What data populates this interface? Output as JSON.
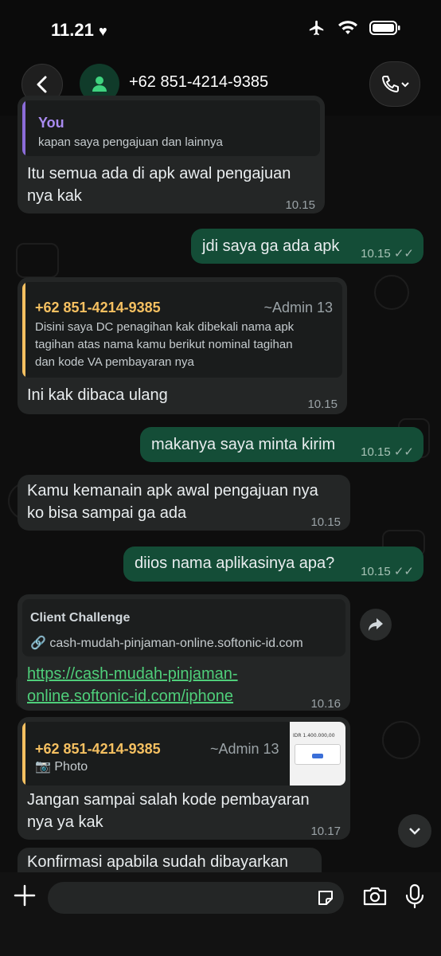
{
  "status_bar": {
    "time": "11.21"
  },
  "header": {
    "contact": "+62 851-4214-9385"
  },
  "messages": [
    {
      "quote_sender": "You",
      "quote_text": "kapan saya pengajuan dan lainnya",
      "text_line1": "Itu semua ada di apk awal pengajuan",
      "text_line2": "nya kak",
      "time": "10.15"
    },
    {
      "text": "jdi saya ga ada apk",
      "time": "10.15"
    },
    {
      "quote_sender": "+62 851-4214-9385",
      "quote_admin": "~Admin 13",
      "quote_line1": "Disini saya DC penagihan kak dibekali nama apk",
      "quote_line2": "tagihan atas nama kamu berikut nominal tagihan",
      "quote_line3": "dan kode VA pembayaran nya",
      "text": "Ini kak dibaca ulang",
      "time": "10.15"
    },
    {
      "text": "makanya saya minta kirim",
      "time": "10.15"
    },
    {
      "text_line1": "Kamu kemanain apk awal pengajuan nya",
      "text_line2": "ko bisa sampai ga ada",
      "time": "10.15"
    },
    {
      "text": "diios nama aplikasinya apa?",
      "time": "10.15"
    },
    {
      "preview_title": "Client Challenge",
      "preview_url": "cash-mudah-pinjaman-online.softonic-id.com",
      "link_line1": "https://cash-mudah-pinjaman-",
      "link_line2": "online.softonic-id.com/iphone",
      "time": "10.16"
    },
    {
      "quote_sender": "+62 851-4214-9385",
      "quote_admin": "~Admin 13",
      "quote_type": "Photo",
      "thumb_text": "IDR 1.400.000,00",
      "text_line1": "Jangan sampai salah kode pembayaran",
      "text_line2": "nya ya kak",
      "time": "10.17"
    },
    {
      "text": "Konfirmasi apabila sudah dibayarkan"
    }
  ],
  "colors": {
    "outgoing": "#144d37",
    "incoming": "#242626",
    "accent_green": "#4fcf7a",
    "quote_sender": "#f5c061",
    "quote_bar_you": "#8b6cd9",
    "quote_bar_other": "#f5c061"
  }
}
